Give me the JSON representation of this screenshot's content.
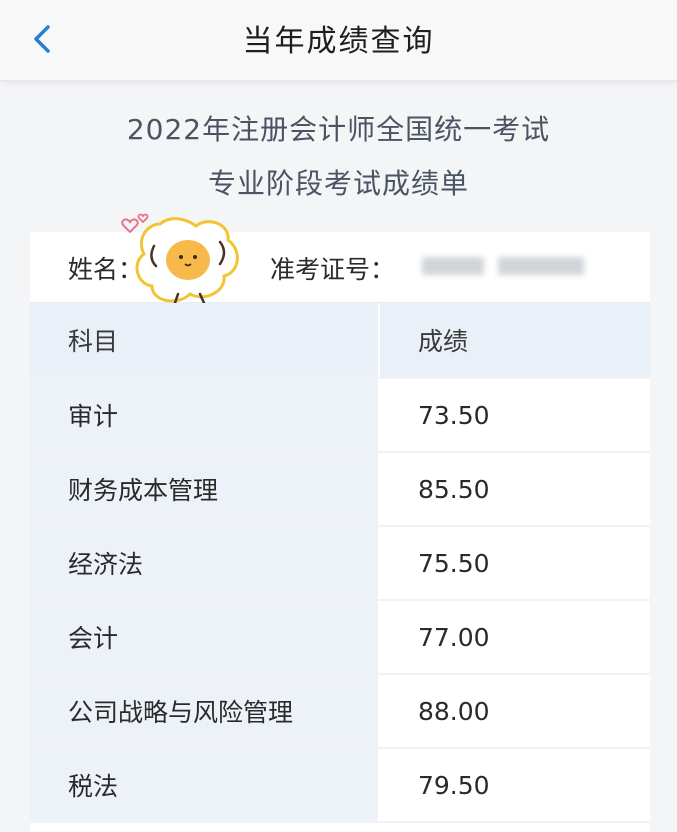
{
  "nav": {
    "title": "当年成绩查询",
    "back_icon": "chevron-left-icon"
  },
  "heading": {
    "line1": "2022年注册会计师全国统一考试",
    "line2": "专业阶段考试成绩单"
  },
  "info": {
    "name_label": "姓名：",
    "ticket_label": "准考证号："
  },
  "table": {
    "headers": [
      "科目",
      "成绩"
    ],
    "rows": [
      {
        "subject": "审计",
        "score": "73.50"
      },
      {
        "subject": "财务成本管理",
        "score": "85.50"
      },
      {
        "subject": "经济法",
        "score": "75.50"
      },
      {
        "subject": "会计",
        "score": "77.00"
      },
      {
        "subject": "公司战略与风险管理",
        "score": "88.00"
      },
      {
        "subject": "税法",
        "score": "79.50"
      }
    ]
  },
  "colors": {
    "accent": "#2a7fd4",
    "subject_bg": "#edf2f8",
    "header_bg": "#eaf0f7"
  }
}
